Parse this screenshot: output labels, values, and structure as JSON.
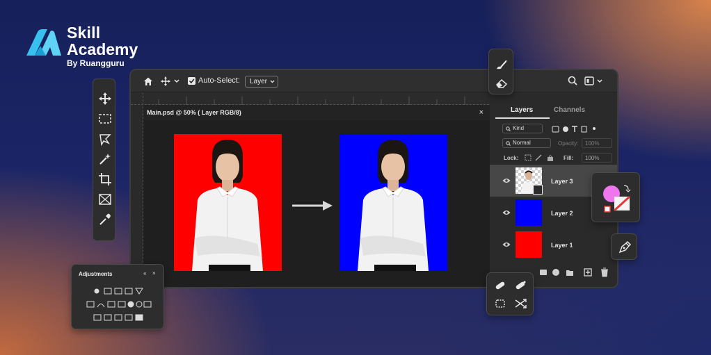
{
  "brand": {
    "line1": "Skill",
    "line2": "Academy",
    "sub": "By Ruangguru"
  },
  "options_bar": {
    "auto_select_label": "Auto-Select:",
    "auto_select_value": "Layer"
  },
  "document": {
    "title": "Main.psd @ 50% ( Layer RGB/8)",
    "close": "×"
  },
  "layers_panel": {
    "tabs": [
      "Layers",
      "Channels"
    ],
    "filter_kind": "Kind",
    "blend_mode": "Normal",
    "opacity_label": "Opacity:",
    "opacity_value": "100%",
    "lock_label": "Lock:",
    "fill_label": "Fill:",
    "fill_value": "100%",
    "layers": [
      {
        "name": "Layer 3",
        "selected": true,
        "thumb": "cutout"
      },
      {
        "name": "Layer 2",
        "selected": false,
        "thumb": "#0000ff"
      },
      {
        "name": "Layer 1",
        "selected": false,
        "thumb": "#ff0000"
      }
    ]
  },
  "adjustments": {
    "title": "Adjustments",
    "collapse": "«",
    "close": "×"
  },
  "colors": {
    "red_bg": "#ff0000",
    "blue_bg": "#0000ff",
    "accent_pink": "#ee77ee"
  }
}
